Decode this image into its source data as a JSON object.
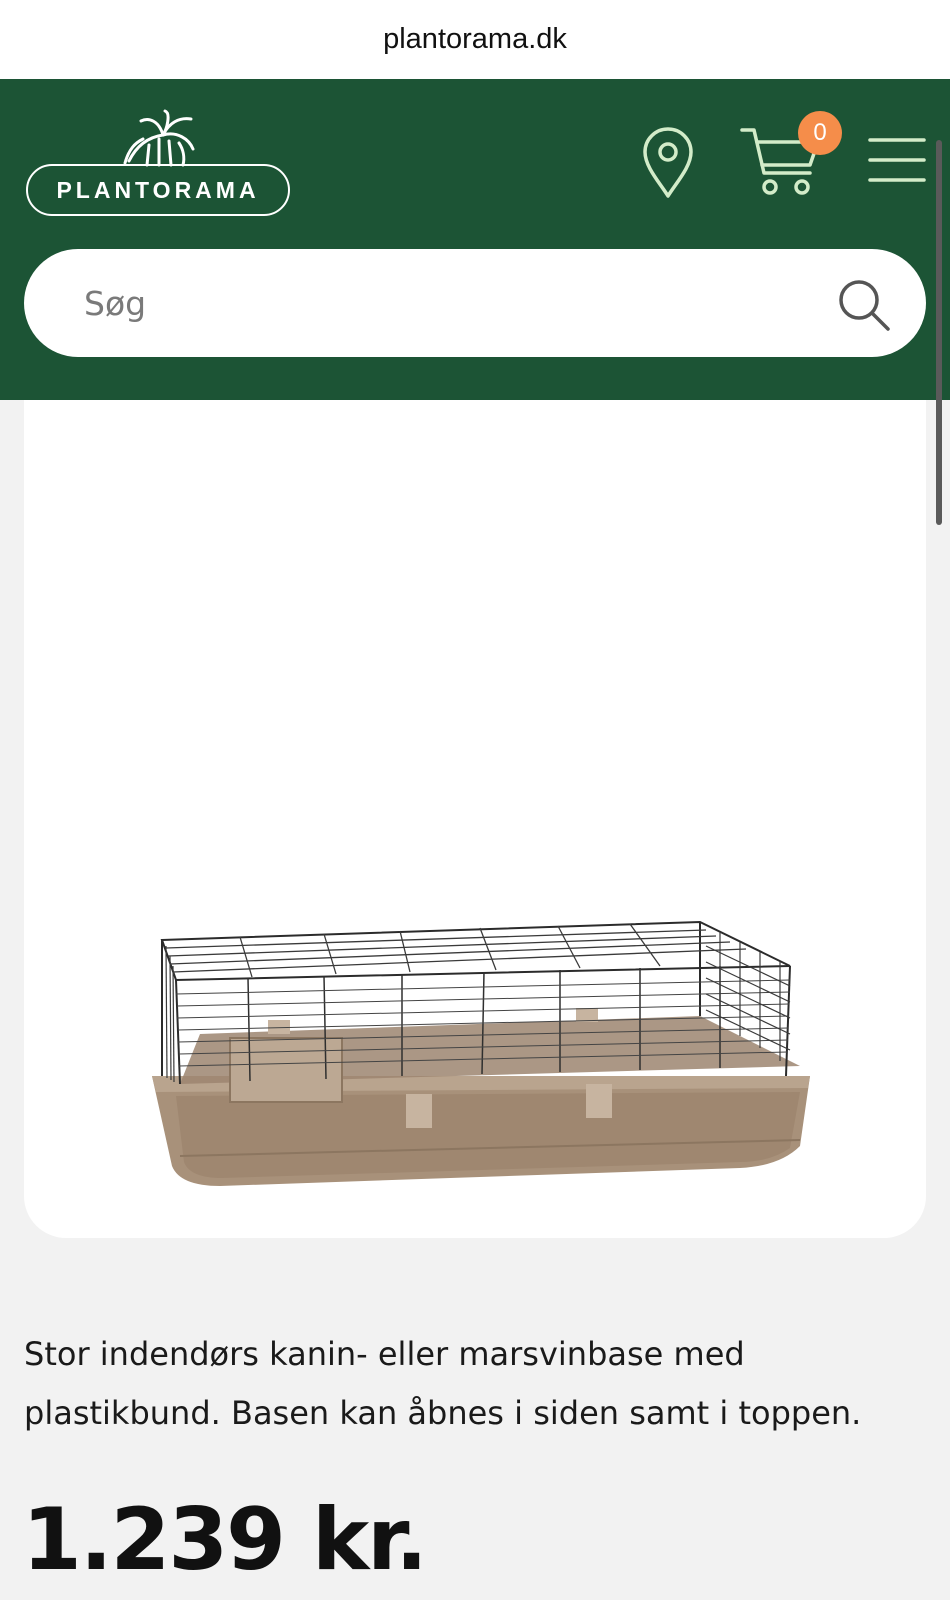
{
  "browser": {
    "url": "plantorama.dk"
  },
  "header": {
    "logo_text": "PLANTORAMA",
    "cart_count": "0",
    "icons": [
      "location-pin-icon",
      "cart-icon",
      "menu-icon"
    ],
    "brand_color": "#1c5435",
    "badge_color": "#f58d4a"
  },
  "search": {
    "placeholder": "Søg",
    "icon": "search-icon"
  },
  "product": {
    "description": "Stor indendørs kanin- eller marsvinbase med plastikbund. Basen kan åbnes i siden samt i toppen.",
    "price": "1.239 kr."
  }
}
